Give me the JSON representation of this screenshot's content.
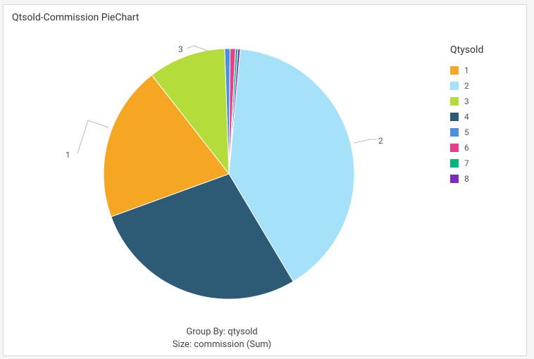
{
  "title": "Qtsold-Commission PieChart",
  "legend": {
    "title": "Qtysold",
    "items": [
      {
        "label": "1",
        "color": "#f5a623"
      },
      {
        "label": "2",
        "color": "#a6e1fa"
      },
      {
        "label": "3",
        "color": "#b4dc3a"
      },
      {
        "label": "4",
        "color": "#2d5a75"
      },
      {
        "label": "5",
        "color": "#4a90e2"
      },
      {
        "label": "6",
        "color": "#e83e8c"
      },
      {
        "label": "7",
        "color": "#00b87c"
      },
      {
        "label": "8",
        "color": "#7b2cbf"
      }
    ]
  },
  "footer": {
    "line1": "Group By: qtysold",
    "line2": "Size: commission (Sum)"
  },
  "slice_labels": {
    "one": "1",
    "two": "2",
    "three": "3"
  },
  "chart_data": {
    "type": "pie",
    "title": "Qtsold-Commission PieChart",
    "group_by": "qtysold",
    "size_metric": "commission (Sum)",
    "series": [
      {
        "name": "1",
        "value": 20.0,
        "color": "#f5a623"
      },
      {
        "name": "2",
        "value": 40.0,
        "color": "#a6e1fa"
      },
      {
        "name": "3",
        "value": 10.0,
        "color": "#b4dc3a"
      },
      {
        "name": "4",
        "value": 28.0,
        "color": "#2d5a75"
      },
      {
        "name": "5",
        "value": 0.7,
        "color": "#4a90e2"
      },
      {
        "name": "6",
        "value": 0.7,
        "color": "#e83e8c"
      },
      {
        "name": "7",
        "value": 0.3,
        "color": "#00b87c"
      },
      {
        "name": "8",
        "value": 0.3,
        "color": "#7b2cbf"
      }
    ]
  }
}
